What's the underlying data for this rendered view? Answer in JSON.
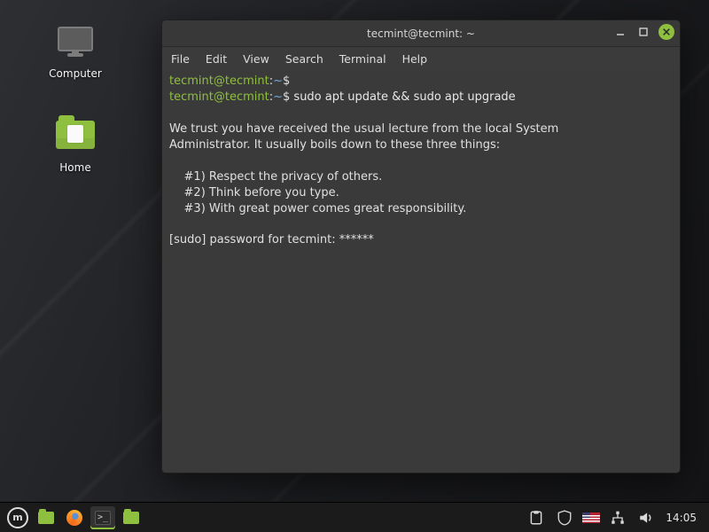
{
  "desktop": {
    "icons": [
      {
        "name": "computer-icon",
        "label": "Computer"
      },
      {
        "name": "home-folder-icon",
        "label": "Home"
      }
    ]
  },
  "window": {
    "title": "tecmint@tecmint: ~",
    "menus": [
      "File",
      "Edit",
      "View",
      "Search",
      "Terminal",
      "Help"
    ]
  },
  "terminal": {
    "user": "tecmint",
    "host": "tecmint",
    "prompt_suffix": "$",
    "path": "~",
    "lines": [
      {
        "type": "prompt",
        "cmd": ""
      },
      {
        "type": "prompt",
        "cmd": "sudo apt update && sudo apt upgrade"
      },
      {
        "type": "blank"
      },
      {
        "type": "text",
        "text": "We trust you have received the usual lecture from the local System"
      },
      {
        "type": "text",
        "text": "Administrator. It usually boils down to these three things:"
      },
      {
        "type": "blank"
      },
      {
        "type": "text",
        "text": "    #1) Respect the privacy of others."
      },
      {
        "type": "text",
        "text": "    #2) Think before you type."
      },
      {
        "type": "text",
        "text": "    #3) With great power comes great responsibility."
      },
      {
        "type": "blank"
      },
      {
        "type": "text",
        "text": "[sudo] password for tecmint: ******"
      }
    ]
  },
  "panel": {
    "launchers": [
      {
        "name": "menu-button",
        "kind": "mint"
      },
      {
        "name": "files-launcher",
        "kind": "folder"
      },
      {
        "name": "firefox-launcher",
        "kind": "firefox"
      },
      {
        "name": "terminal-taskbar-item",
        "kind": "terminal",
        "running": true
      },
      {
        "name": "files-taskbar-item",
        "kind": "folder"
      }
    ],
    "tray": [
      {
        "name": "clipboard-indicator",
        "glyph": "📋"
      },
      {
        "name": "update-manager-indicator",
        "glyph": "🛡"
      },
      {
        "name": "keyboard-layout-indicator",
        "glyph": "flag"
      },
      {
        "name": "network-indicator",
        "glyph": "nw"
      },
      {
        "name": "sound-indicator",
        "glyph": "🔊"
      }
    ],
    "clock": "14:05"
  }
}
